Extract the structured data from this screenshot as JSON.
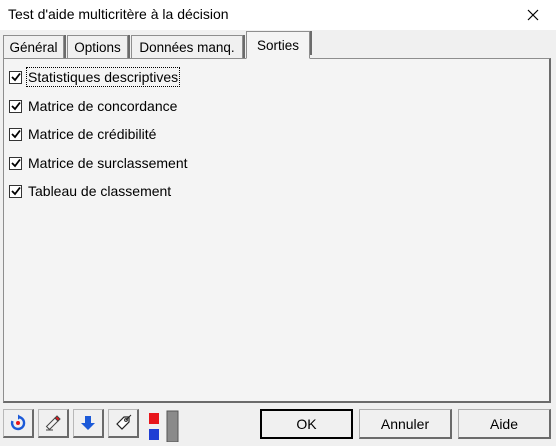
{
  "window": {
    "title": "Test d'aide multicritère à la décision"
  },
  "tabs": [
    {
      "label": "Général",
      "selected": false
    },
    {
      "label": "Options",
      "selected": false
    },
    {
      "label": "Données manq.",
      "selected": false
    },
    {
      "label": "Sorties",
      "selected": true
    }
  ],
  "checkboxes": [
    {
      "label": "Statistiques descriptives",
      "checked": true
    },
    {
      "label": "Matrice de concordance",
      "checked": true
    },
    {
      "label": "Matrice de crédibilité",
      "checked": true
    },
    {
      "label": "Matrice de surclassement",
      "checked": true
    },
    {
      "label": "Tableau de classement",
      "checked": true
    }
  ],
  "toolbar": {
    "icons": [
      "reset-icon",
      "eraser-icon",
      "down-arrow-icon",
      "tag-icon",
      "color-indicator-icon"
    ]
  },
  "buttons": {
    "ok": "OK",
    "cancel": "Annuler",
    "help": "Aide"
  },
  "colors": {
    "accent_blue": "#1c5ad8",
    "indicator_red": "#e8161b",
    "indicator_blue": "#1f3ed4"
  }
}
